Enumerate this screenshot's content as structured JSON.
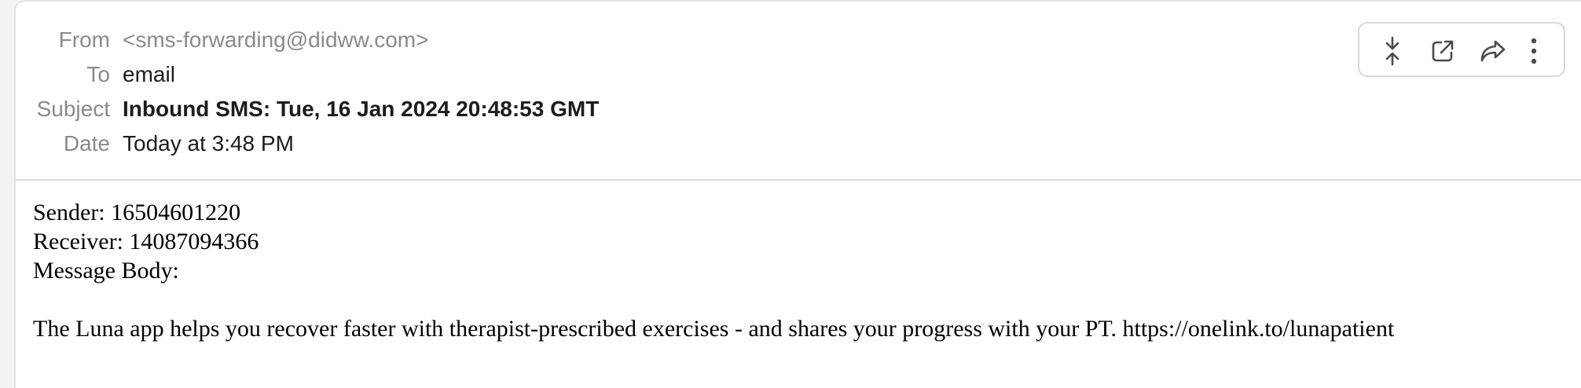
{
  "header": {
    "from_label": "From",
    "from_value": "<sms-forwarding@didww.com>",
    "to_label": "To",
    "to_value": "email",
    "subject_label": "Subject",
    "subject_value": "Inbound SMS: Tue, 16 Jan 2024 20:48:53 GMT",
    "date_label": "Date",
    "date_value": "Today at 3:48 PM"
  },
  "toolbar": {
    "icons": [
      "collapse-icon",
      "open-external-icon",
      "forward-icon",
      "more-options-icon"
    ]
  },
  "message": {
    "sender_line": "Sender: 16504601220",
    "receiver_line": "Receiver: 14087094366",
    "body_label": "Message Body:",
    "body_text": "The Luna app helps you recover faster with therapist-prescribed exercises - and shares your progress with your PT. https://onelink.to/lunapatient"
  },
  "colors": {
    "label": "#8a8a8a",
    "value": "#1c1c1c",
    "border": "#dcdcdc",
    "background": "#ffffff"
  }
}
